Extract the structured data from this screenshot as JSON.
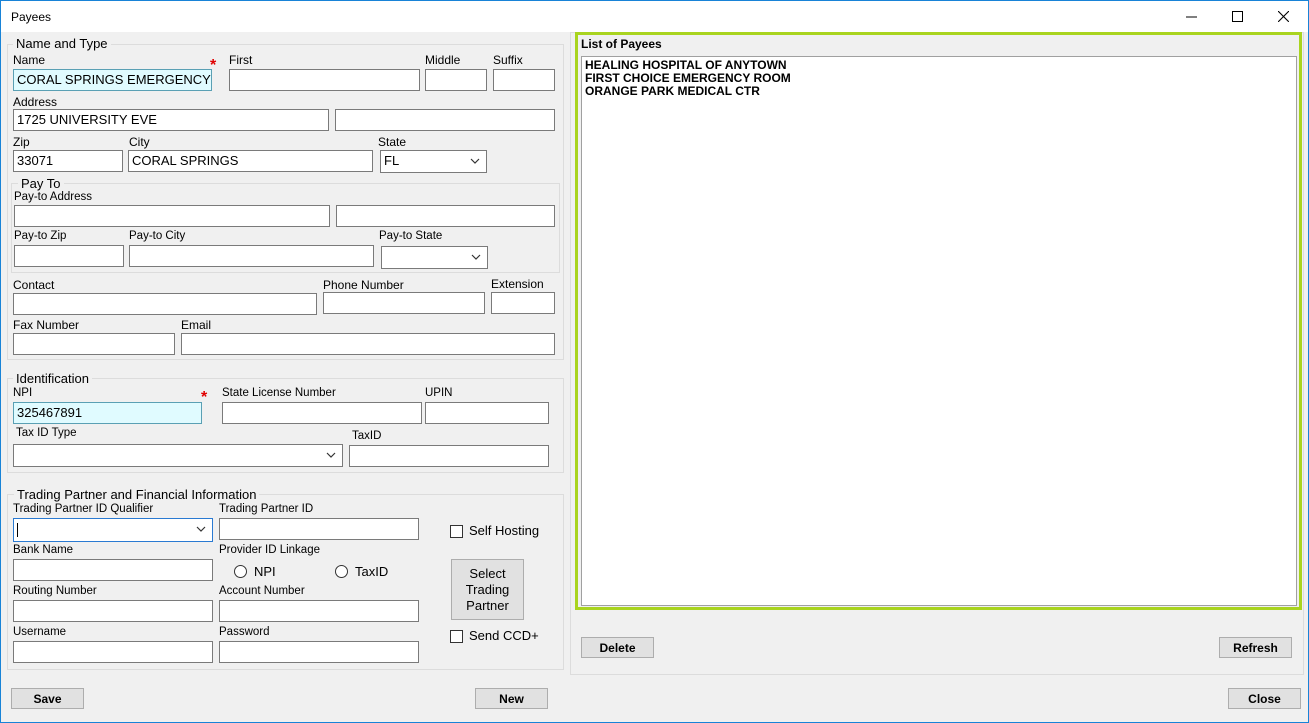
{
  "window": {
    "title": "Payees",
    "minimize_glyph": "—",
    "maximize_glyph": "☐",
    "close_glyph": "✕"
  },
  "name_type": {
    "group_title": "Name and Type",
    "name_label": "Name",
    "name_value": "CORAL SPRINGS EMERGENCY",
    "first_label": "First",
    "first_value": "",
    "middle_label": "Middle",
    "middle_value": "",
    "suffix_label": "Suffix",
    "suffix_value": "",
    "address_label": "Address",
    "address_value": "1725 UNIVERSITY EVE",
    "address2_value": "",
    "zip_label": "Zip",
    "zip_value": "33071",
    "city_label": "City",
    "city_value": "CORAL SPRINGS",
    "state_label": "State",
    "state_value": "FL"
  },
  "pay_to": {
    "group_title": "Pay To",
    "address_label": "Pay-to Address",
    "address_value": "",
    "address2_value": "",
    "zip_label": "Pay-to Zip",
    "zip_value": "",
    "city_label": "Pay-to City",
    "city_value": "",
    "state_label": "Pay-to State",
    "state_value": ""
  },
  "contact": {
    "contact_label": "Contact",
    "contact_value": "",
    "phone_label": "Phone Number",
    "phone_value": "",
    "extension_label": "Extension",
    "extension_value": "",
    "fax_label": "Fax Number",
    "fax_value": "",
    "email_label": "Email",
    "email_value": ""
  },
  "identification": {
    "group_title": "Identification",
    "npi_label": "NPI",
    "npi_value": "325467891",
    "state_license_label": "State License Number",
    "state_license_value": "",
    "upin_label": "UPIN",
    "upin_value": "",
    "tax_id_type_label": "Tax ID Type",
    "tax_id_type_value": "",
    "tax_id_label": "TaxID",
    "tax_id_value": ""
  },
  "trading": {
    "group_title": "Trading Partner and Financial Information",
    "tp_id_qualifier_label": "Trading Partner ID Qualifier",
    "tp_id_qualifier_value": "",
    "tp_id_label": "Trading Partner ID",
    "tp_id_value": "",
    "self_hosting_label": "Self Hosting",
    "bank_name_label": "Bank Name",
    "bank_name_value": "",
    "provider_linkage_label": "Provider ID Linkage",
    "npi_option": "NPI",
    "taxid_option": "TaxID",
    "select_tp_label_1": "Select",
    "select_tp_label_2": "Trading",
    "select_tp_label_3": "Partner",
    "routing_label": "Routing Number",
    "routing_value": "",
    "account_label": "Account Number",
    "account_value": "",
    "send_ccd_label": "Send CCD+",
    "username_label": "Username",
    "username_value": "",
    "password_label": "Password",
    "password_value": ""
  },
  "payees": {
    "title": "List of Payees",
    "items": [
      "HEALING HOSPITAL OF ANYTOWN",
      "FIRST CHOICE EMERGENCY ROOM",
      "ORANGE PARK MEDICAL CTR"
    ],
    "delete_label": "Delete",
    "refresh_label": "Refresh"
  },
  "footer": {
    "save_label": "Save",
    "new_label": "New",
    "close_label": "Close"
  },
  "colors": {
    "required_bg": "#e0fbff",
    "required_star": "#e00000",
    "list_highlight": "#a9d41f",
    "window_border": "#1883d7"
  }
}
